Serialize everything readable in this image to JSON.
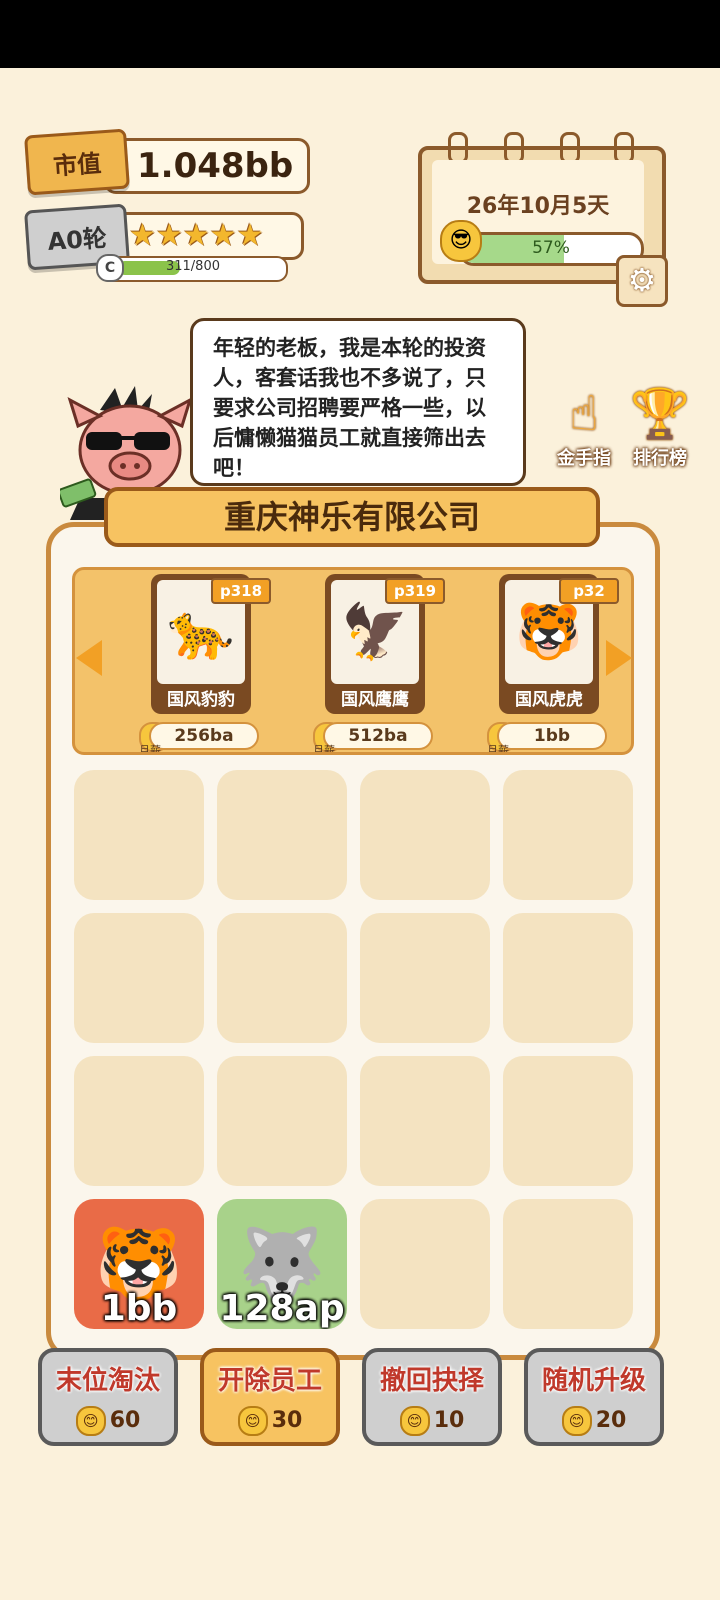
{
  "header": {
    "market_value_label": "市值",
    "market_value": "1.048bb",
    "round_label": "A0轮",
    "stars": 5,
    "stars_glyphs": "★★★★★",
    "exp_grade": "C",
    "exp_text": "311/800",
    "exp_progress": 0.39
  },
  "calendar": {
    "date": "26年10月5天",
    "mood_percent": "57%",
    "mood_progress": 0.57
  },
  "dialog": {
    "text": "年轻的老板，我是本轮的投资人，客套话我也不多说了，只要求公司招聘要严格一些，以后慵懒猫猫员工就直接筛出去吧！"
  },
  "side_buttons": {
    "cheat": "金手指",
    "ranking": "排行榜"
  },
  "company": {
    "name": "重庆神乐有限公司"
  },
  "candidates": [
    {
      "tag": "p318",
      "name": "国风豹豹",
      "salary": "256ba",
      "salary_unit": "月薪"
    },
    {
      "tag": "p319",
      "name": "国风鹰鹰",
      "salary": "512ba",
      "salary_unit": "月薪"
    },
    {
      "tag": "p32",
      "name": "国风虎虎",
      "salary": "1bb",
      "salary_unit": "月薪"
    }
  ],
  "employees": [
    {
      "level": "1bb",
      "icon": "tiger-employee"
    },
    {
      "level": "128ap",
      "icon": "wolf-employee"
    }
  ],
  "actions": [
    {
      "label": "末位淘汰",
      "cost": "60"
    },
    {
      "label": "开除员工",
      "cost": "30"
    },
    {
      "label": "撤回抉择",
      "cost": "10"
    },
    {
      "label": "随机升级",
      "cost": "20"
    }
  ],
  "colors": {
    "background": "#fbf1db",
    "accent": "#f7c361",
    "border": "#8b5a2b"
  }
}
